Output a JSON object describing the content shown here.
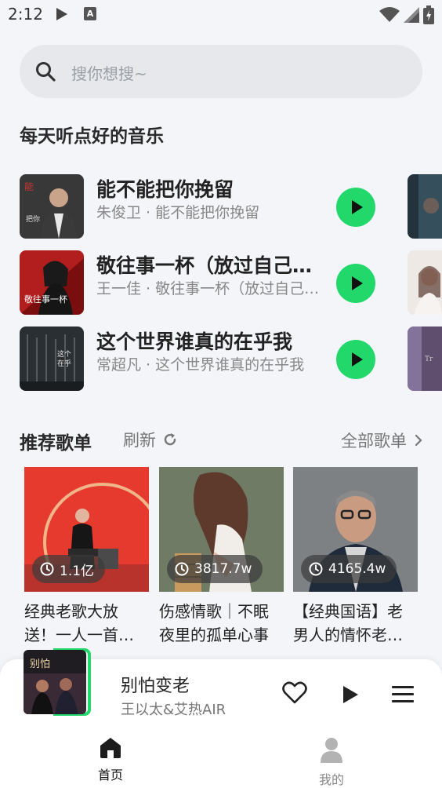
{
  "status": {
    "time": "2:12"
  },
  "search": {
    "placeholder": "搜你想搜~"
  },
  "daily": {
    "title": "每天听点好的音乐",
    "songs": [
      {
        "title": "能不能把你挽留",
        "subtitle": "朱俊卫 · 能不能把你挽留"
      },
      {
        "title": "敬往事一杯（放过自己语气版）",
        "subtitle": "王一佳 · 敬往事一杯（放过自己语气版）"
      },
      {
        "title": "这个世界谁真的在乎我",
        "subtitle": "常超凡 · 这个世界谁真的在乎我"
      }
    ]
  },
  "recommend": {
    "title": "推荐歌单",
    "refresh_label": "刷新",
    "all_label": "全部歌单",
    "playlists": [
      {
        "count": "1.1亿",
        "name": "经典老歌大放送！一人一首代表作"
      },
      {
        "count": "3817.7w",
        "name": "伤感情歌｜不眠夜里的孤单心事"
      },
      {
        "count": "4165.4w",
        "name": "【经典国语】老男人的情怀老男人的歌"
      }
    ]
  },
  "player": {
    "title": "别怕变老",
    "artist": "王以太&艾热AIR"
  },
  "nav": {
    "home": "首页",
    "mine": "我的"
  },
  "colors": {
    "accent": "#22d86a",
    "background": "#f3f5f8"
  }
}
